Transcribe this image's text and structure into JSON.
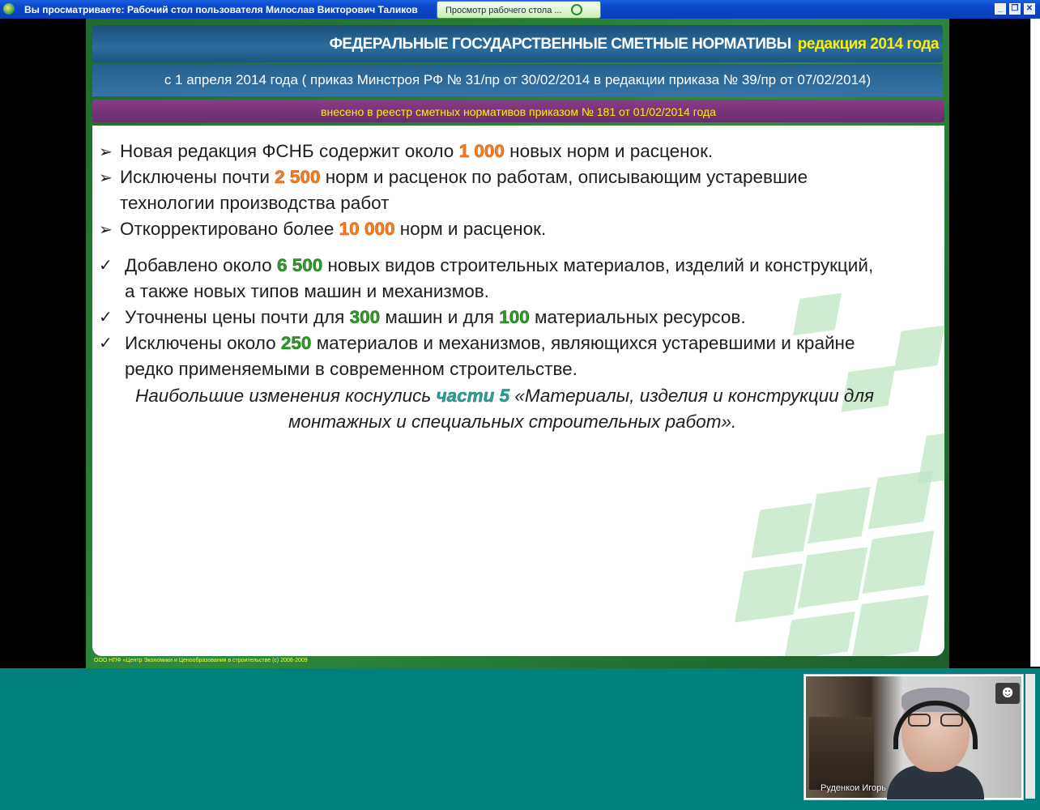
{
  "window": {
    "title": "Вы просматриваете: Рабочий стол пользователя Милослав Викторович Таликов",
    "view_tab_label": "Просмотр рабочего стола ...",
    "controls": {
      "minimize": "_",
      "restore": "❐",
      "close": "✕"
    }
  },
  "slide": {
    "header1_main": "ФЕДЕРАЛЬНЫЕ ГОСУДАРСТВЕННЫЕ СМЕТНЫЕ НОРМАТИВЫ",
    "header1_year": "редакция 2014 года",
    "header2": "с 1 апреля 2014 года  ( приказ Минстроя РФ  № 31/пр от 30/02/2014  в редакции приказа № 39/пр от 07/02/2014)",
    "header3": "внесено в реестр сметных нормативов  приказом № 181 от 01/02/2014 года",
    "bullets": {
      "b1": {
        "pre": "Новая редакция ФСНБ содержит около ",
        "num": "1 000",
        "post": " новых норм и расценок."
      },
      "b2": {
        "pre": "Исключены почти ",
        "num": "2 500",
        "post": " норм и расценок по работам, описывающим устаревшие",
        "line2": "технологии производства работ"
      },
      "b3": {
        "pre": "Откорректировано более ",
        "num": "10 000",
        "post": " норм и расценок."
      },
      "c1": {
        "pre": "Добавлено около ",
        "num": "6 500",
        "post": " новых видов строительных материалов, изделий и конструкций,",
        "line2": "а также новых типов машин и механизмов."
      },
      "c2": {
        "pre": "Уточнены цены почти для ",
        "num1": "300",
        "mid": " машин и для ",
        "num2": "100",
        "post": " материальных ресурсов."
      },
      "c3": {
        "pre": "Исключены около ",
        "num": "250",
        "post": " материалов и механизмов, являющихся устаревшими и крайне",
        "line2": "редко применяемыми в современном строительстве."
      }
    },
    "note": {
      "pre": "Наибольшие изменения коснулись ",
      "num": "части 5",
      "post": " «Материалы, изделия и конструкции для",
      "line2": "монтажных и специальных строительных работ»."
    },
    "marks": {
      "arrow": "➢",
      "check": "✓"
    },
    "footer": "ООО НПФ «Центр Экономики и Ценообразования в строительстве  (с) 2008-2009"
  },
  "video": {
    "participant_name": "Руденкои Игорь",
    "participants_icon": "group-icon"
  },
  "colors": {
    "accent_orange": "#ff7a1a",
    "accent_green": "#2f9a2a",
    "accent_teal": "#2aa090",
    "background_teal": "#00807e"
  }
}
